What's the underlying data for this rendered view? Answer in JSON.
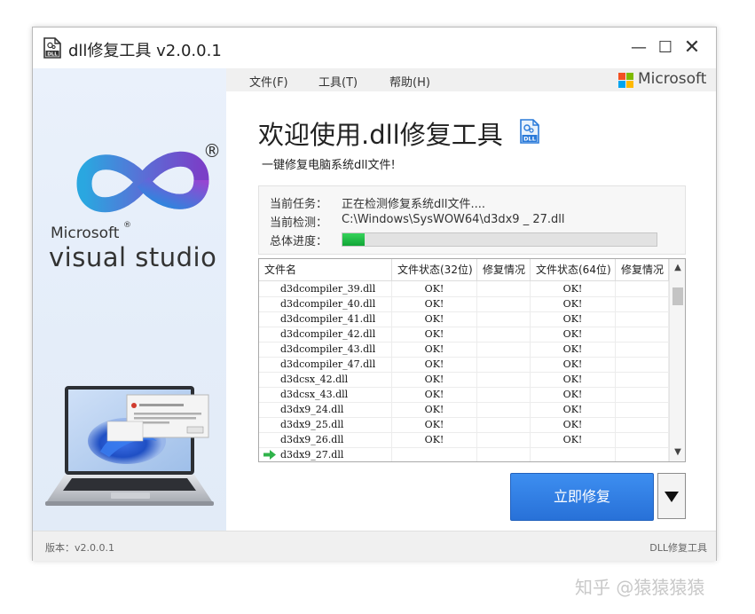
{
  "window": {
    "title": "dll修复工具 v2.0.0.1",
    "controls": {
      "minimize": "—",
      "maximize": "☐",
      "close": "✕"
    }
  },
  "sidebar": {
    "brand_microsoft": "Microsoft",
    "brand_reg": "®",
    "brand_product": "visual studio",
    "logo_reg": "®"
  },
  "menu": {
    "items": [
      {
        "label": "文件(F)"
      },
      {
        "label": "工具(T)"
      },
      {
        "label": "帮助(H)"
      }
    ],
    "ms_brand": "Microsoft"
  },
  "main": {
    "welcome_title": "欢迎使用.dll修复工具",
    "subtitle": "一键修复电脑系统dll文件!",
    "title_icon_text": "DLL"
  },
  "status": {
    "task_label": "当前任务：",
    "task_value": "正在检测修复系统dll文件....",
    "check_label": "当前检测：",
    "check_value": "C:\\Windows\\SysWOW64\\d3dx9 _ 27.dll",
    "progress_label": "总体进度：",
    "progress_fraction": 0.07
  },
  "table": {
    "headers": [
      "文件名",
      "文件状态(32位)",
      "修复情况",
      "文件状态(64位)",
      "修复情况"
    ],
    "rows": [
      {
        "name": "d3dcompiler_39.dll",
        "s32": "OK!",
        "r32": "",
        "s64": "OK!",
        "r64": ""
      },
      {
        "name": "d3dcompiler_40.dll",
        "s32": "OK!",
        "r32": "",
        "s64": "OK!",
        "r64": ""
      },
      {
        "name": "d3dcompiler_41.dll",
        "s32": "OK!",
        "r32": "",
        "s64": "OK!",
        "r64": ""
      },
      {
        "name": "d3dcompiler_42.dll",
        "s32": "OK!",
        "r32": "",
        "s64": "OK!",
        "r64": ""
      },
      {
        "name": "d3dcompiler_43.dll",
        "s32": "OK!",
        "r32": "",
        "s64": "OK!",
        "r64": ""
      },
      {
        "name": "d3dcompiler_47.dll",
        "s32": "OK!",
        "r32": "",
        "s64": "OK!",
        "r64": ""
      },
      {
        "name": "d3dcsx_42.dll",
        "s32": "OK!",
        "r32": "",
        "s64": "OK!",
        "r64": ""
      },
      {
        "name": "d3dcsx_43.dll",
        "s32": "OK!",
        "r32": "",
        "s64": "OK!",
        "r64": ""
      },
      {
        "name": "d3dx9_24.dll",
        "s32": "OK!",
        "r32": "",
        "s64": "OK!",
        "r64": ""
      },
      {
        "name": "d3dx9_25.dll",
        "s32": "OK!",
        "r32": "",
        "s64": "OK!",
        "r64": ""
      },
      {
        "name": "d3dx9_26.dll",
        "s32": "OK!",
        "r32": "",
        "s64": "OK!",
        "r64": ""
      },
      {
        "name": "d3dx9_27.dll",
        "s32": "",
        "r32": "",
        "s64": "",
        "r64": "",
        "current": true
      }
    ],
    "scroll_up": "▲",
    "scroll_down": "▼"
  },
  "actions": {
    "repair_label": "立即修复"
  },
  "footer": {
    "version": "版本：v2.0.0.1",
    "product": "DLL修复工具"
  },
  "watermark": "知乎 @猿猿猿猿",
  "colors": {
    "accent_blue": "#2f7fe6",
    "progress_green": "#1db544",
    "sidebar_bg": "#e6eefa"
  },
  "icons": [
    "app-dll-icon",
    "visual-studio-logo",
    "microsoft-logo",
    "current-row-arrow-icon",
    "dropdown-arrow-icon"
  ]
}
